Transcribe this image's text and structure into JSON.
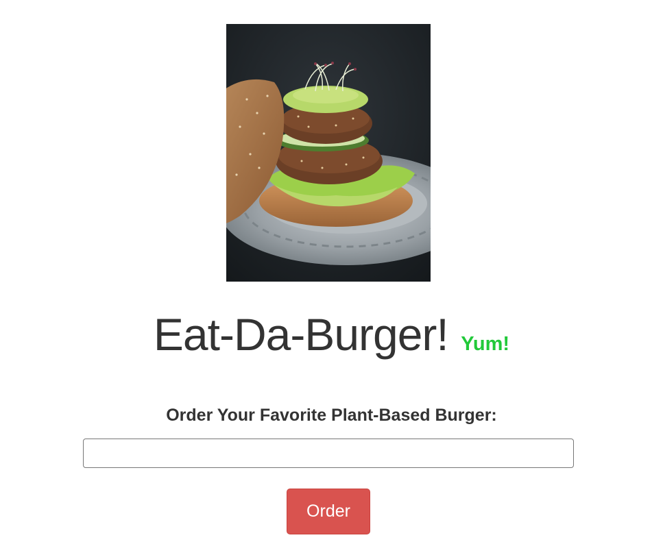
{
  "hero_image": {
    "subject": "plant-based burger photo",
    "colors": {
      "background": "#1d2226",
      "plate": "#a7adb1",
      "bun": "#c58a55",
      "patty": "#6b3f26",
      "lettuce": "#9ccf4a",
      "avocado": "#b7d86a",
      "cucumber": "#4e7d2f"
    }
  },
  "header": {
    "title": "Eat-Da-Burger!",
    "tagline": "Yum!",
    "tagline_color": "#22c93a"
  },
  "order_form": {
    "label": "Order Your Favorite Plant-Based Burger:",
    "input_value": "",
    "input_placeholder": "",
    "button_label": "Order",
    "button_color": "#d9534f"
  }
}
